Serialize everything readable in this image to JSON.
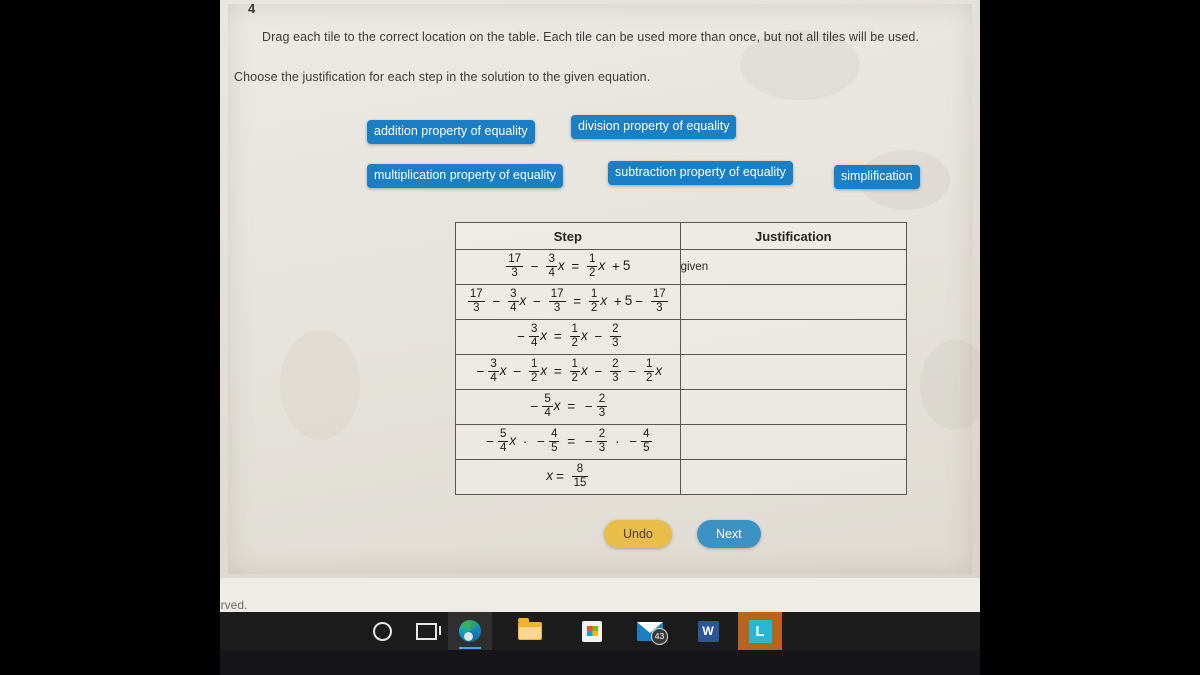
{
  "page": {
    "page_number": "4",
    "footer_text": "erved."
  },
  "instructions": {
    "line1": "Drag each tile to the correct location on the table. Each tile can be used more than once, but not all tiles will be used.",
    "line2": "Choose the justification for each step in the solution to the given equation."
  },
  "tiles": [
    {
      "label": "addition property of equality"
    },
    {
      "label": "division property of equality"
    },
    {
      "label": "multiplication property of equality"
    },
    {
      "label": "subtraction property of equality"
    },
    {
      "label": "simplification"
    }
  ],
  "table": {
    "headers": {
      "step": "Step",
      "justification": "Justification"
    },
    "rows": [
      {
        "step_text": "17/3 - 3/4 x = 1/2 x + 5",
        "justification": "given"
      },
      {
        "step_text": "17/3 - 3/4 x - 17/3 = 1/2 x + 5 - 17/3",
        "justification": ""
      },
      {
        "step_text": "-3/4 x = 1/2 x - 2/3",
        "justification": ""
      },
      {
        "step_text": "-3/4 x - 1/2 x = 1/2 x - 2/3 - 1/2 x",
        "justification": ""
      },
      {
        "step_text": "-5/4 x = -2/3",
        "justification": ""
      },
      {
        "step_text": "-5/4 x . -4/5 = -2/3 . -4/5",
        "justification": ""
      },
      {
        "step_text": "x = 8/15",
        "justification": ""
      }
    ]
  },
  "buttons": {
    "undo": "Undo",
    "next": "Next"
  },
  "taskbar": {
    "items": [
      {
        "name": "cortana",
        "label": ""
      },
      {
        "name": "task-view",
        "label": ""
      },
      {
        "name": "edge",
        "label": ""
      },
      {
        "name": "file-explorer",
        "label": ""
      },
      {
        "name": "microsoft-store",
        "label": ""
      },
      {
        "name": "mail",
        "label": "",
        "badge": "43"
      },
      {
        "name": "word",
        "label": "W"
      },
      {
        "name": "l-app",
        "label": "L"
      }
    ]
  },
  "colors": {
    "tile_blue": "#1a7fc4",
    "undo_gold": "#e8bd4a",
    "next_blue": "#3c92c4",
    "taskbar_black": "#1c1c1c"
  }
}
